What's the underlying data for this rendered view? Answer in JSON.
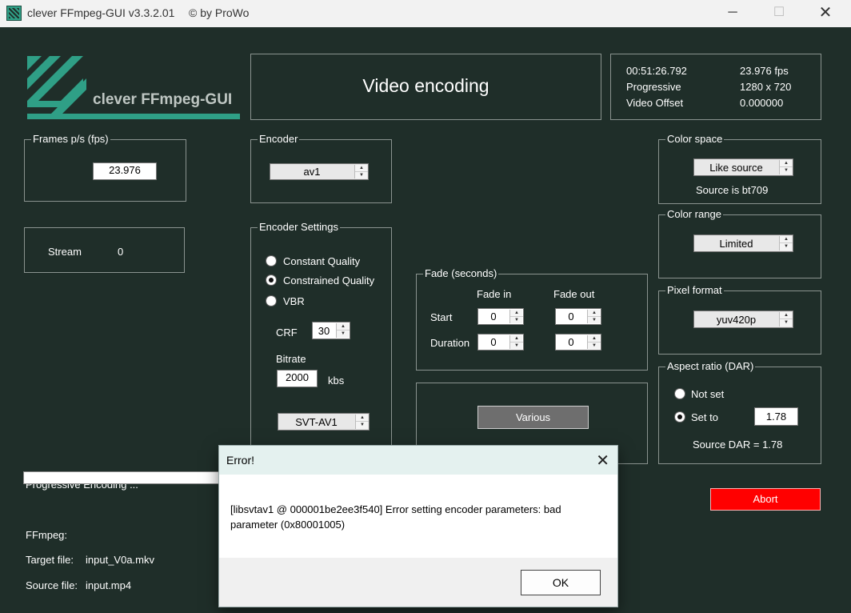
{
  "window": {
    "title": "clever FFmpeg-GUI v3.3.2.01",
    "byline": "© by ProWo",
    "minimize_glyph": "─",
    "maximize_glyph": "☐",
    "close_glyph": "✕"
  },
  "logo": {
    "text": "clever FFmpeg-GUI",
    "color": "#2f9f86"
  },
  "header": {
    "title": "Video encoding"
  },
  "source_info": {
    "duration": "00:51:26.792",
    "fps": "23.976 fps",
    "scan": "Progressive",
    "resolution": "1280 x 720",
    "offset_label": "Video Offset",
    "offset_value": "0.000000"
  },
  "frames": {
    "legend": "Frames p/s (fps)",
    "value": "23.976"
  },
  "stream": {
    "label": "Stream",
    "value": "0"
  },
  "encoder": {
    "legend": "Encoder",
    "value": "av1"
  },
  "encoder_settings": {
    "legend": "Encoder Settings",
    "modes": [
      {
        "label": "Constant Quality",
        "checked": false
      },
      {
        "label": "Constrained Quality",
        "checked": true
      },
      {
        "label": "VBR",
        "checked": false
      }
    ],
    "crf_label": "CRF",
    "crf_value": "30",
    "bitrate_label": "Bitrate",
    "bitrate_value": "2000",
    "bitrate_unit": "kbs",
    "library_value": "SVT-AV1"
  },
  "fade": {
    "legend": "Fade (seconds)",
    "fade_in_label": "Fade in",
    "fade_out_label": "Fade out",
    "start_label": "Start",
    "duration_label": "Duration",
    "start_in": "0",
    "start_out": "0",
    "duration_in": "0",
    "duration_out": "0"
  },
  "various": {
    "label": "Various"
  },
  "color_space": {
    "legend": "Color space",
    "value": "Like source",
    "note": "Source is bt709"
  },
  "color_range": {
    "legend": "Color range",
    "value": "Limited"
  },
  "pixel_format": {
    "legend": "Pixel format",
    "value": "yuv420p"
  },
  "aspect": {
    "legend": "Aspect ratio (DAR)",
    "not_set_label": "Not set",
    "set_to_label": "Set to",
    "value": "1.78",
    "note": "Source DAR = 1.78",
    "selected": "set_to"
  },
  "status": {
    "progress_label": "Progressive Encoding ...",
    "ffmpeg_label": "FFmpeg:",
    "target_label": "Target file:",
    "target_value": "input_V0a.mkv",
    "source_label": "Source file:",
    "source_value": "input.mp4"
  },
  "abort": {
    "label": "Abort",
    "color": "#ff0000"
  },
  "error_dialog": {
    "title": "Error!",
    "close_glyph": "✕",
    "message": "[libsvtav1 @ 000001be2ee3f540] Error setting encoder parameters: bad parameter (0x80001005)",
    "ok_label": "OK"
  },
  "colors": {
    "background": "#1f2e29",
    "accent": "#2f9f86"
  }
}
